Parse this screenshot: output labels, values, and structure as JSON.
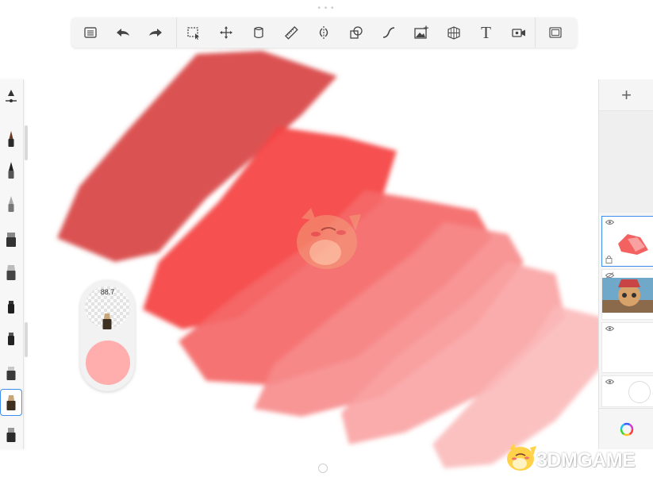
{
  "app": {
    "colors": {
      "toolbar_bg": "#f4f4f4",
      "panel_bg": "#f5f5f5",
      "selection_accent": "#3d8ef0",
      "current_color": "#ffadad",
      "stroke_colors": [
        "#d94848",
        "#f64646",
        "#f46767",
        "#f78b8b",
        "#f9a3a3",
        "#fbb8b8"
      ]
    }
  },
  "toolbar": {
    "groups": [
      [
        {
          "name": "gallery-list-button",
          "icon": "list-icon"
        },
        {
          "name": "undo-button",
          "icon": "undo-arrow-icon"
        },
        {
          "name": "redo-button",
          "icon": "redo-arrow-icon"
        }
      ],
      [
        {
          "name": "selection-tool-button",
          "icon": "marquee-select-icon"
        },
        {
          "name": "transform-tool-button",
          "icon": "move-arrows-icon"
        },
        {
          "name": "fill-tool-button",
          "icon": "paint-bucket-icon"
        },
        {
          "name": "ruler-tool-button",
          "icon": "ruler-icon"
        },
        {
          "name": "symmetry-tool-button",
          "icon": "symmetry-icon"
        },
        {
          "name": "shape-tool-button",
          "icon": "shapes-icon"
        },
        {
          "name": "curve-tool-button",
          "icon": "curve-icon"
        },
        {
          "name": "image-import-button",
          "icon": "image-add-icon"
        },
        {
          "name": "perspective-guide-button",
          "icon": "perspective-grid-icon"
        },
        {
          "name": "text-tool-button",
          "icon": "text-icon",
          "label": "T"
        },
        {
          "name": "time-lapse-button",
          "icon": "video-camera-icon"
        }
      ],
      [
        {
          "name": "fullscreen-button",
          "icon": "fullscreen-frame-icon"
        }
      ]
    ]
  },
  "brush_panel": {
    "brushes": [
      {
        "name": "brush-slider",
        "icon": "size-slider-icon"
      },
      {
        "name": "brush-pencil",
        "icon": "pencil-brush-icon"
      },
      {
        "name": "brush-ink-pen",
        "icon": "ink-pen-icon"
      },
      {
        "name": "brush-marker-pen",
        "icon": "marker-pen-icon"
      },
      {
        "name": "brush-airbrush",
        "icon": "airbrush-icon"
      },
      {
        "name": "brush-paint-tube",
        "icon": "paint-tube-icon"
      },
      {
        "name": "brush-chisel-marker",
        "icon": "chisel-marker-icon"
      },
      {
        "name": "brush-felt-marker",
        "icon": "felt-marker-icon"
      },
      {
        "name": "brush-eraser",
        "icon": "eraser-icon"
      },
      {
        "name": "brush-soft-marker",
        "icon": "soft-marker-icon",
        "selected": true
      },
      {
        "name": "brush-blender",
        "icon": "blender-icon"
      }
    ]
  },
  "color_puck": {
    "opacity_value": "88.7",
    "current_color": "#ffadad"
  },
  "layers": {
    "add_label": "+",
    "items": [
      {
        "name": "layer-1",
        "visible": true,
        "selected": true,
        "content": "red-strokes-thumbnail"
      },
      {
        "name": "layer-2",
        "visible": false,
        "selected": false,
        "content": "character-image-thumbnail"
      },
      {
        "name": "layer-3",
        "visible": true,
        "selected": false,
        "content": "blank"
      },
      {
        "name": "background-layer",
        "visible": true,
        "selected": false,
        "content": "white-background"
      }
    ]
  },
  "watermark": {
    "text": "3DMGAME"
  }
}
